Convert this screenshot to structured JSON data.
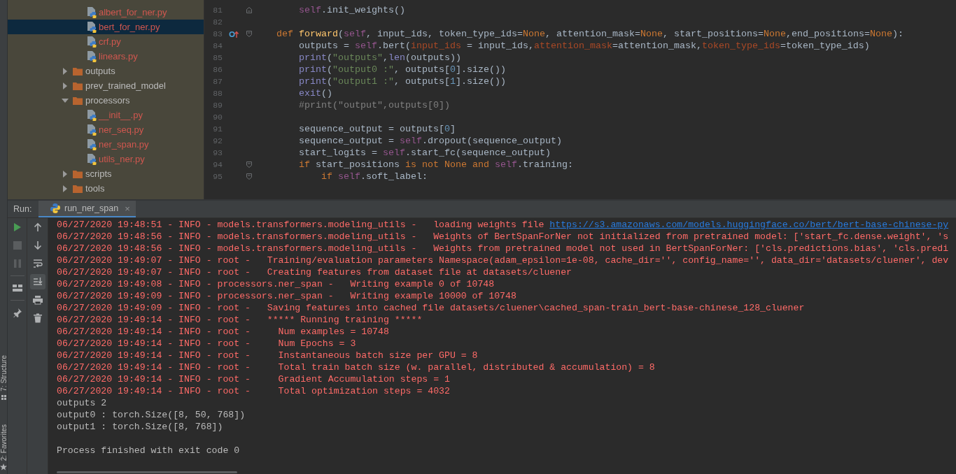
{
  "side_tabs": [
    {
      "kind": "structure",
      "label": "7: Structure"
    },
    {
      "kind": "favorites",
      "label": "2: Favorites"
    }
  ],
  "project_tree": {
    "items": [
      {
        "kind": "group",
        "children": [
          {
            "kind": "file",
            "label": "albert_for_ner.py",
            "selected": false
          },
          {
            "kind": "file",
            "label": "bert_for_ner.py",
            "selected": true
          },
          {
            "kind": "file",
            "label": "crf.py",
            "selected": false
          },
          {
            "kind": "file",
            "label": "linears.py",
            "selected": false
          }
        ]
      },
      {
        "kind": "folder",
        "label": "outputs",
        "expanded": false,
        "selected": false
      },
      {
        "kind": "folder",
        "label": "prev_trained_model",
        "expanded": false,
        "selected": false
      },
      {
        "kind": "folder",
        "label": "processors",
        "expanded": true,
        "selected": false,
        "children": [
          {
            "kind": "file",
            "label": "__init__.py",
            "selected": false
          },
          {
            "kind": "file",
            "label": "ner_seq.py",
            "selected": false
          },
          {
            "kind": "file",
            "label": "ner_span.py",
            "selected": false
          },
          {
            "kind": "file",
            "label": "utils_ner.py",
            "selected": false
          }
        ]
      },
      {
        "kind": "folder",
        "label": "scripts",
        "expanded": false,
        "selected": false
      },
      {
        "kind": "folder",
        "label": "tools",
        "expanded": false,
        "selected": false
      }
    ]
  },
  "editor": {
    "lines": [
      {
        "number": "81",
        "fold_end": true,
        "tokens": [
          {
            "kind": "self",
            "text": "        self"
          },
          {
            "kind": "plain",
            "text": ".init_weights()"
          }
        ]
      },
      {
        "number": "82"
      },
      {
        "number": "83",
        "fold_start": true,
        "override_marker": true,
        "tokens": [
          {
            "kind": "kw",
            "text": "    def "
          },
          {
            "kind": "fn",
            "text": "forward"
          },
          {
            "kind": "plain",
            "text": "("
          },
          {
            "kind": "self",
            "text": "self"
          },
          {
            "kind": "plain",
            "text": ", input_ids, token_type_ids="
          },
          {
            "kind": "kw",
            "text": "None"
          },
          {
            "kind": "plain",
            "text": ", attention_mask="
          },
          {
            "kind": "kw",
            "text": "None"
          },
          {
            "kind": "plain",
            "text": ", start_positions="
          },
          {
            "kind": "kw",
            "text": "None"
          },
          {
            "kind": "plain",
            "text": ",end_positions="
          },
          {
            "kind": "kw",
            "text": "None"
          },
          {
            "kind": "plain",
            "text": "):"
          }
        ]
      },
      {
        "number": "84",
        "tokens": [
          {
            "kind": "plain",
            "text": "        outputs = "
          },
          {
            "kind": "self",
            "text": "self"
          },
          {
            "kind": "plain",
            "text": ".bert("
          },
          {
            "kind": "arg",
            "text": "input_ids "
          },
          {
            "kind": "plain",
            "text": "= input_ids,"
          },
          {
            "kind": "arg",
            "text": "attention_mask"
          },
          {
            "kind": "plain",
            "text": "=attention_mask,"
          },
          {
            "kind": "arg",
            "text": "token_type_ids"
          },
          {
            "kind": "plain",
            "text": "=token_type_ids)"
          }
        ]
      },
      {
        "number": "85",
        "tokens": [
          {
            "kind": "builtin",
            "text": "        print"
          },
          {
            "kind": "plain",
            "text": "("
          },
          {
            "kind": "str",
            "text": "\"outputs\""
          },
          {
            "kind": "plain",
            "text": ","
          },
          {
            "kind": "builtin",
            "text": "len"
          },
          {
            "kind": "plain",
            "text": "(outputs))"
          }
        ]
      },
      {
        "number": "86",
        "tokens": [
          {
            "kind": "builtin",
            "text": "        print"
          },
          {
            "kind": "plain",
            "text": "("
          },
          {
            "kind": "str",
            "text": "\"output0 :\""
          },
          {
            "kind": "plain",
            "text": ", outputs["
          },
          {
            "kind": "num",
            "text": "0"
          },
          {
            "kind": "plain",
            "text": "].size())"
          }
        ]
      },
      {
        "number": "87",
        "tokens": [
          {
            "kind": "builtin",
            "text": "        print"
          },
          {
            "kind": "plain",
            "text": "("
          },
          {
            "kind": "str",
            "text": "\"output1 :\""
          },
          {
            "kind": "plain",
            "text": ", outputs["
          },
          {
            "kind": "num",
            "text": "1"
          },
          {
            "kind": "plain",
            "text": "].size())"
          }
        ]
      },
      {
        "number": "88",
        "tokens": [
          {
            "kind": "builtin",
            "text": "        exit"
          },
          {
            "kind": "plain",
            "text": "()"
          }
        ]
      },
      {
        "number": "89",
        "tokens": [
          {
            "kind": "comment",
            "text": "        #print(\"output\",outputs[0])"
          }
        ]
      },
      {
        "number": "90"
      },
      {
        "number": "91",
        "tokens": [
          {
            "kind": "plain",
            "text": "        sequence_output = outputs["
          },
          {
            "kind": "num",
            "text": "0"
          },
          {
            "kind": "plain",
            "text": "]"
          }
        ]
      },
      {
        "number": "92",
        "tokens": [
          {
            "kind": "plain",
            "text": "        sequence_output = "
          },
          {
            "kind": "self",
            "text": "self"
          },
          {
            "kind": "plain",
            "text": ".dropout(sequence_output)"
          }
        ]
      },
      {
        "number": "93",
        "tokens": [
          {
            "kind": "plain",
            "text": "        start_logits = "
          },
          {
            "kind": "self",
            "text": "self"
          },
          {
            "kind": "plain",
            "text": ".start_fc(sequence_output)"
          }
        ]
      },
      {
        "number": "94",
        "fold_start": true,
        "tokens": [
          {
            "kind": "kw",
            "text": "        if "
          },
          {
            "kind": "plain",
            "text": "start_positions "
          },
          {
            "kind": "kw",
            "text": "is not None and "
          },
          {
            "kind": "self",
            "text": "self"
          },
          {
            "kind": "plain",
            "text": ".training:"
          }
        ]
      },
      {
        "number": "95",
        "fold_start": true,
        "tokens": [
          {
            "kind": "kw",
            "text": "            if "
          },
          {
            "kind": "self",
            "text": "self"
          },
          {
            "kind": "plain",
            "text": ".soft_label:"
          }
        ]
      }
    ]
  },
  "run_panel": {
    "label": "Run:",
    "tabs": [
      {
        "label": "run_ner_span",
        "close": "×",
        "selected": true
      }
    ],
    "toolbar_left": [
      {
        "kind": "run",
        "disabled": false
      },
      {
        "kind": "stop",
        "disabled": true
      },
      {
        "kind": "pause",
        "disabled": true,
        "separator_after": true
      },
      {
        "kind": "layout",
        "disabled": false,
        "separator_after": true
      },
      {
        "kind": "pin",
        "disabled": false
      }
    ],
    "toolbar_right": [
      {
        "kind": "up",
        "on": false
      },
      {
        "kind": "down",
        "on": false
      },
      {
        "kind": "wrap",
        "on": false
      },
      {
        "kind": "scroll_end",
        "on": true
      },
      {
        "kind": "print",
        "on": false
      },
      {
        "kind": "trash",
        "on": false
      }
    ],
    "console": [
      {
        "error": true,
        "text": "06/27/2020 19:48:51 - INFO - models.transformers.modeling_utils -   loading weights file ",
        "link": "https://s3.amazonaws.com/models.huggingface.co/bert/bert-base-chinese-py"
      },
      {
        "error": true,
        "text": "06/27/2020 19:48:56 - INFO - models.transformers.modeling_utils -   Weights of BertSpanForNer not initialized from pretrained model: ['start_fc.dense.weight', 's"
      },
      {
        "error": true,
        "text": "06/27/2020 19:48:56 - INFO - models.transformers.modeling_utils -   Weights from pretrained model not used in BertSpanForNer: ['cls.predictions.bias', 'cls.predi"
      },
      {
        "error": true,
        "text": "06/27/2020 19:49:07 - INFO - root -   Training/evaluation parameters Namespace(adam_epsilon=1e-08, cache_dir='', config_name='', data_dir='datasets/cluener', dev"
      },
      {
        "error": true,
        "text": "06/27/2020 19:49:07 - INFO - root -   Creating features from dataset file at datasets/cluener"
      },
      {
        "error": true,
        "text": "06/27/2020 19:49:08 - INFO - processors.ner_span -   Writing example 0 of 10748"
      },
      {
        "error": true,
        "text": "06/27/2020 19:49:09 - INFO - processors.ner_span -   Writing example 10000 of 10748"
      },
      {
        "error": true,
        "text": "06/27/2020 19:49:09 - INFO - root -   Saving features into cached file datasets/cluener\\cached_span-train_bert-base-chinese_128_cluener"
      },
      {
        "error": true,
        "text": "06/27/2020 19:49:14 - INFO - root -   ***** Running training *****"
      },
      {
        "error": true,
        "text": "06/27/2020 19:49:14 - INFO - root -     Num examples = 10748"
      },
      {
        "error": true,
        "text": "06/27/2020 19:49:14 - INFO - root -     Num Epochs = 3"
      },
      {
        "error": true,
        "text": "06/27/2020 19:49:14 - INFO - root -     Instantaneous batch size per GPU = 8"
      },
      {
        "error": true,
        "text": "06/27/2020 19:49:14 - INFO - root -     Total train batch size (w. parallel, distributed & accumulation) = 8"
      },
      {
        "error": true,
        "text": "06/27/2020 19:49:14 - INFO - root -     Gradient Accumulation steps = 1"
      },
      {
        "error": true,
        "text": "06/27/2020 19:49:14 - INFO - root -     Total optimization steps = 4032"
      },
      {
        "error": false,
        "text": "outputs 2"
      },
      {
        "error": false,
        "text": "output0 : torch.Size([8, 50, 768])"
      },
      {
        "error": false,
        "text": "output1 : torch.Size([8, 768])"
      },
      {
        "error": false,
        "text": "Process finished with exit code 0",
        "gap_before": true
      }
    ]
  }
}
